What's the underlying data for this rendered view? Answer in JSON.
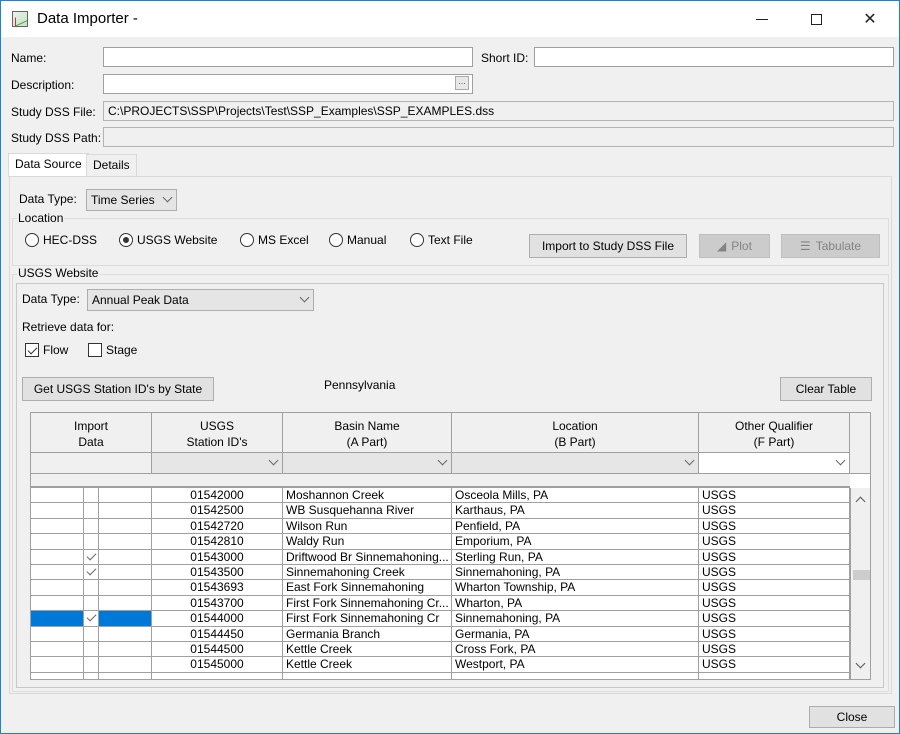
{
  "window": {
    "title": "Data Importer -",
    "controls": {
      "minimize": "minimize",
      "maximize": "maximize",
      "close": "close"
    }
  },
  "form": {
    "name_label": "Name:",
    "name_value": "",
    "short_id_label": "Short ID:",
    "short_id_value": "",
    "description_label": "Description:",
    "description_value": "",
    "description_button": "...",
    "dss_file_label": "Study DSS File:",
    "dss_file_value": "C:\\PROJECTS\\SSP\\Projects\\Test\\SSP_Examples\\SSP_EXAMPLES.dss",
    "dss_path_label": "Study DSS Path:",
    "dss_path_value": ""
  },
  "tabs": [
    {
      "label": "Data Source",
      "active": true
    },
    {
      "label": "Details",
      "active": false
    }
  ],
  "data_source": {
    "data_type_label": "Data Type:",
    "data_type_value": "Time Series",
    "location_group_title": "Location",
    "location_options": [
      {
        "label": "HEC-DSS",
        "selected": false
      },
      {
        "label": "USGS Website",
        "selected": true
      },
      {
        "label": "MS Excel",
        "selected": false
      },
      {
        "label": "Manual",
        "selected": false
      },
      {
        "label": "Text File",
        "selected": false
      }
    ],
    "import_button": "Import to Study DSS File",
    "plot_button": "Plot",
    "tabulate_button": "Tabulate"
  },
  "usgs": {
    "group_title": "USGS Website",
    "data_type_label": "Data Type:",
    "data_type_value": "Annual Peak Data",
    "retrieve_label": "Retrieve data for:",
    "flow_label": "Flow",
    "flow_checked": true,
    "stage_label": "Stage",
    "stage_checked": false,
    "get_ids_button": "Get USGS Station ID's by State",
    "state_value": "Pennsylvania",
    "clear_button": "Clear Table"
  },
  "table": {
    "headers": [
      [
        "Import",
        "Data"
      ],
      [
        "USGS",
        "Station ID's"
      ],
      [
        "Basin Name",
        "(A Part)"
      ],
      [
        "Location",
        "(B Part)"
      ],
      [
        "Other Qualifier",
        "(F Part)"
      ]
    ],
    "rows": [
      {
        "checked": false,
        "id": "01542000",
        "basin": "Moshannon Creek",
        "location": "Osceola Mills, PA",
        "qualifier": "USGS",
        "selected": false
      },
      {
        "checked": false,
        "id": "01542500",
        "basin": "WB Susquehanna River",
        "location": "Karthaus, PA",
        "qualifier": "USGS",
        "selected": false
      },
      {
        "checked": false,
        "id": "01542720",
        "basin": "Wilson Run",
        "location": "Penfield, PA",
        "qualifier": "USGS",
        "selected": false
      },
      {
        "checked": false,
        "id": "01542810",
        "basin": "Waldy Run",
        "location": "Emporium, PA",
        "qualifier": "USGS",
        "selected": false
      },
      {
        "checked": true,
        "id": "01543000",
        "basin": "Driftwood Br Sinnemahoning...",
        "location": "Sterling Run, PA",
        "qualifier": "USGS",
        "selected": false
      },
      {
        "checked": true,
        "id": "01543500",
        "basin": "Sinnemahoning Creek",
        "location": "Sinnemahoning, PA",
        "qualifier": "USGS",
        "selected": false
      },
      {
        "checked": false,
        "id": "01543693",
        "basin": "East Fork Sinnemahoning",
        "location": "Wharton Township, PA",
        "qualifier": "USGS",
        "selected": false
      },
      {
        "checked": false,
        "id": "01543700",
        "basin": "First Fork Sinnemahoning Cr...",
        "location": "Wharton, PA",
        "qualifier": "USGS",
        "selected": false
      },
      {
        "checked": true,
        "id": "01544000",
        "basin": "First Fork Sinnemahoning Cr",
        "location": "Sinnemahoning, PA",
        "qualifier": "USGS",
        "selected": true
      },
      {
        "checked": false,
        "id": "01544450",
        "basin": "Germania Branch",
        "location": "Germania, PA",
        "qualifier": "USGS",
        "selected": false
      },
      {
        "checked": false,
        "id": "01544500",
        "basin": "Kettle Creek",
        "location": "Cross Fork, PA",
        "qualifier": "USGS",
        "selected": false
      },
      {
        "checked": false,
        "id": "01545000",
        "basin": "Kettle Creek",
        "location": "Westport, PA",
        "qualifier": "USGS",
        "selected": false
      },
      {
        "checked": false,
        "id": "",
        "basin": "",
        "location": "",
        "qualifier": "",
        "selected": false
      }
    ]
  },
  "footer": {
    "close_button": "Close"
  }
}
